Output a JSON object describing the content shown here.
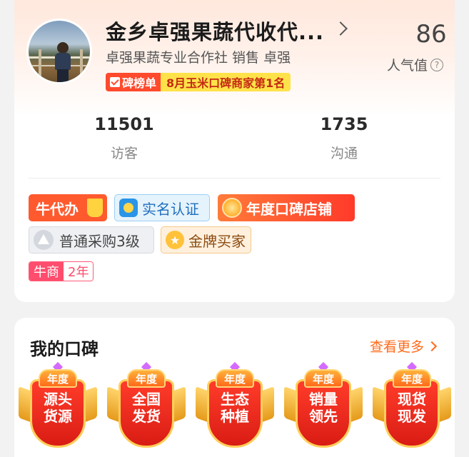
{
  "profile": {
    "shop_name": "金乡卓强果蔬代收代...",
    "subtitle": "卓强果蔬专业合作社  销售  卓强",
    "board_badge_label": "碑榜单",
    "board_badge_rank": "8月玉米口碑商家第1名",
    "popularity_value": "86",
    "popularity_label": "人气值",
    "help_glyph": "?"
  },
  "stats": [
    {
      "value": "11501",
      "label": "访客"
    },
    {
      "value": "1735",
      "label": "沟通"
    }
  ],
  "tags": {
    "niudaiban": "牛代办",
    "shiming": "实名认证",
    "niandu": "年度口碑店铺",
    "caigou": "普通采购3级",
    "jinpai": "金牌买家",
    "niushang_a": "牛商",
    "niushang_b": "2年"
  },
  "reputation": {
    "title": "我的口碑",
    "more_label": "查看更多",
    "award_cap": "年度",
    "awards": [
      {
        "line1": "源头",
        "line2": "货源"
      },
      {
        "line1": "全国",
        "line2": "发货"
      },
      {
        "line1": "生态",
        "line2": "种植"
      },
      {
        "line1": "销量",
        "line2": "领先"
      },
      {
        "line1": "现货",
        "line2": "现发"
      }
    ]
  },
  "colors": {
    "accent": "#ff6a1a",
    "badge_red": "#ff4a2d",
    "badge_yellow": "#ffe24a"
  }
}
